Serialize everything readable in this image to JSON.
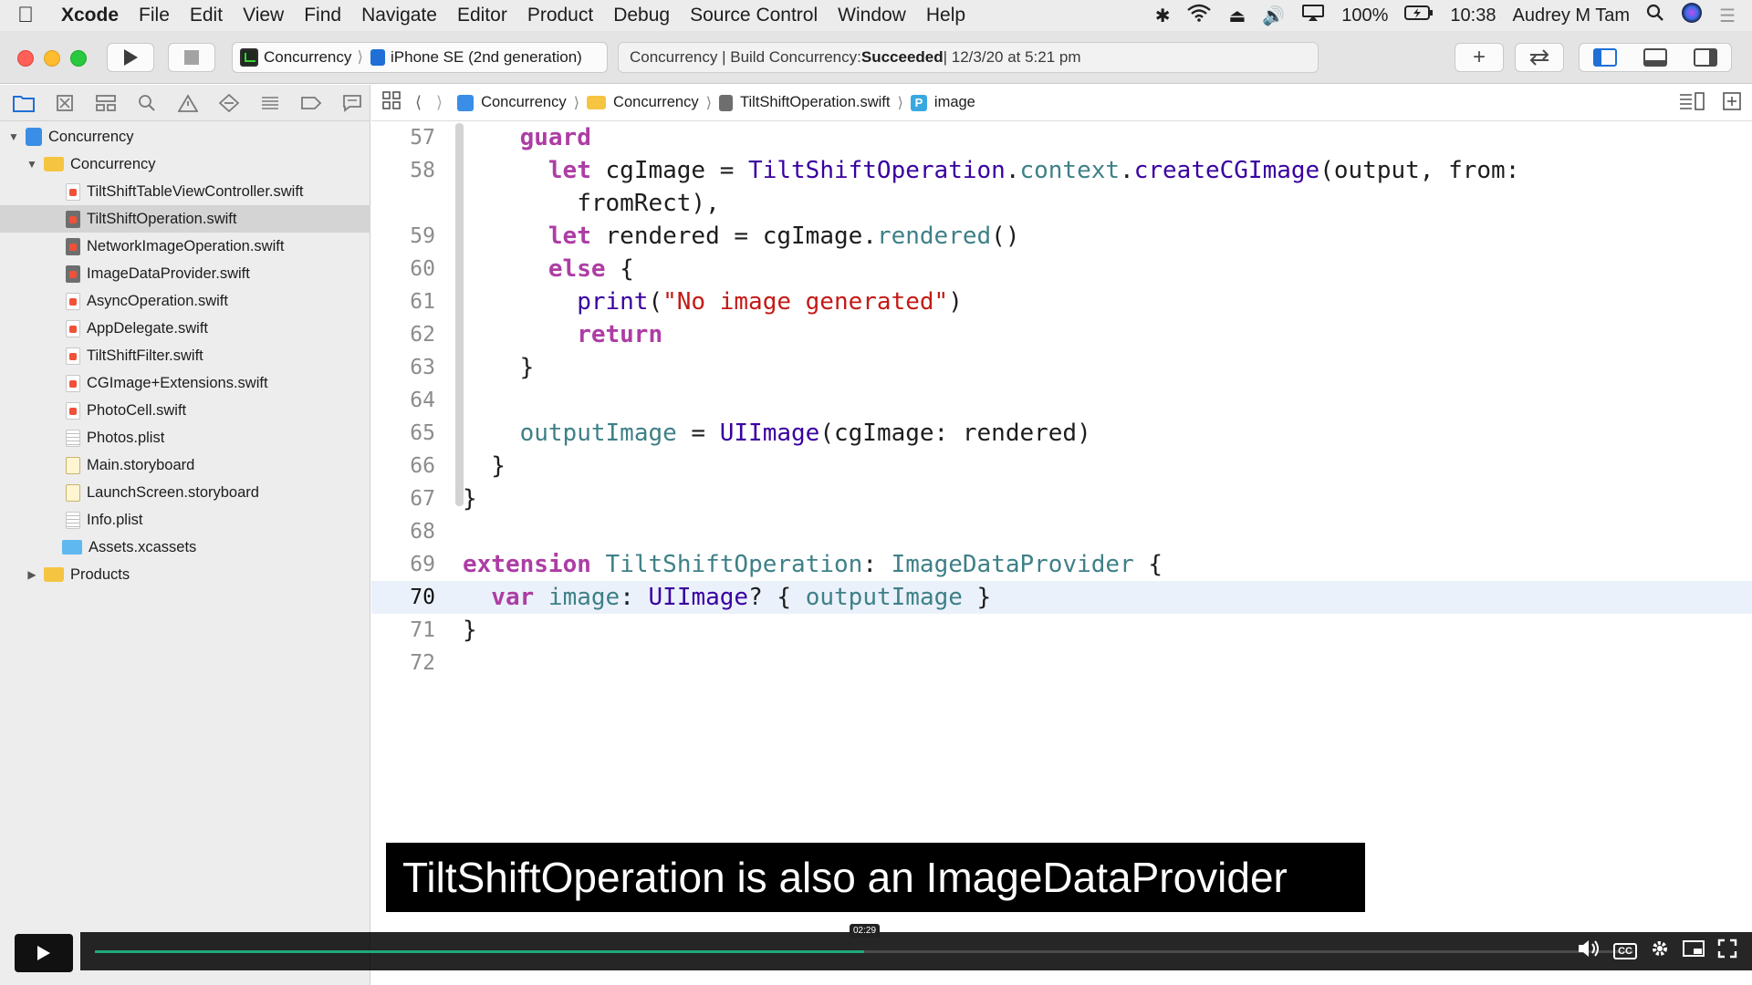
{
  "menubar": {
    "app_name": "Xcode",
    "items": [
      "File",
      "Edit",
      "View",
      "Find",
      "Navigate",
      "Editor",
      "Product",
      "Debug",
      "Source Control",
      "Window",
      "Help"
    ],
    "battery": "100%",
    "clock": "10:38",
    "user": "Audrey M Tam"
  },
  "toolbar": {
    "scheme_name": "Concurrency",
    "device_name": "iPhone SE (2nd generation)",
    "activity_prefix": "Concurrency | Build Concurrency: ",
    "activity_status": "Succeeded",
    "activity_suffix": " | 12/3/20 at 5:21 pm",
    "add_label": "+"
  },
  "navigator": {
    "project": "Concurrency",
    "group": "Concurrency",
    "files": [
      {
        "name": "TiltShiftTableViewController.swift",
        "kind": "swift"
      },
      {
        "name": "TiltShiftOperation.swift",
        "kind": "swift",
        "selected": true
      },
      {
        "name": "NetworkImageOperation.swift",
        "kind": "swift"
      },
      {
        "name": "ImageDataProvider.swift",
        "kind": "swift"
      },
      {
        "name": "AsyncOperation.swift",
        "kind": "swift"
      },
      {
        "name": "AppDelegate.swift",
        "kind": "swift"
      },
      {
        "name": "TiltShiftFilter.swift",
        "kind": "swift"
      },
      {
        "name": "CGImage+Extensions.swift",
        "kind": "swift"
      },
      {
        "name": "PhotoCell.swift",
        "kind": "swift"
      },
      {
        "name": "Photos.plist",
        "kind": "plist"
      },
      {
        "name": "Main.storyboard",
        "kind": "storyboard"
      },
      {
        "name": "LaunchScreen.storyboard",
        "kind": "storyboard"
      },
      {
        "name": "Info.plist",
        "kind": "plist"
      },
      {
        "name": "Assets.xcassets",
        "kind": "assets"
      }
    ],
    "products": "Products"
  },
  "jumpbar": {
    "crumbs": [
      "Concurrency",
      "Concurrency",
      "TiltShiftOperation.swift",
      "image"
    ],
    "symbol_badge": "P"
  },
  "code": {
    "line_numbers": [
      "57",
      "58",
      "",
      "59",
      "60",
      "61",
      "62",
      "63",
      "64",
      "65",
      "66",
      "67",
      "68",
      "69",
      "70",
      "71",
      "72"
    ],
    "current_line": "70"
  },
  "caption": "TiltShiftOperation is also an ImageDataProvider",
  "player": {
    "timestamp": "02:29",
    "progress": 0.5
  }
}
